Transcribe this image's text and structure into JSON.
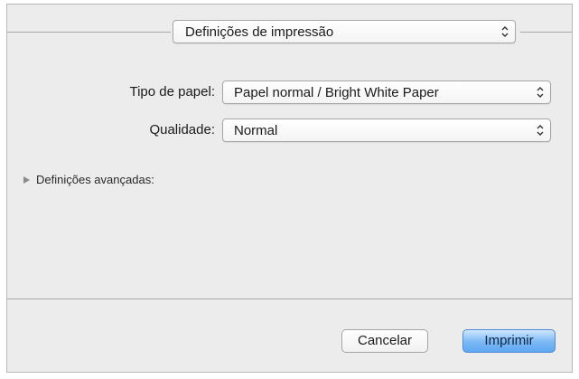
{
  "header": {
    "panel_select_value": "Definições de impressão"
  },
  "settings": {
    "paper_type_label": "Tipo de papel:",
    "paper_type_value": "Papel normal / Bright White Paper",
    "quality_label": "Qualidade:",
    "quality_value": "Normal"
  },
  "advanced": {
    "label": "Definições avançadas:",
    "expanded": false
  },
  "footer": {
    "cancel_label": "Cancelar",
    "print_label": "Imprimir"
  },
  "colors": {
    "dialog_bg": "#ececec",
    "default_button": "#7ab8f5"
  }
}
